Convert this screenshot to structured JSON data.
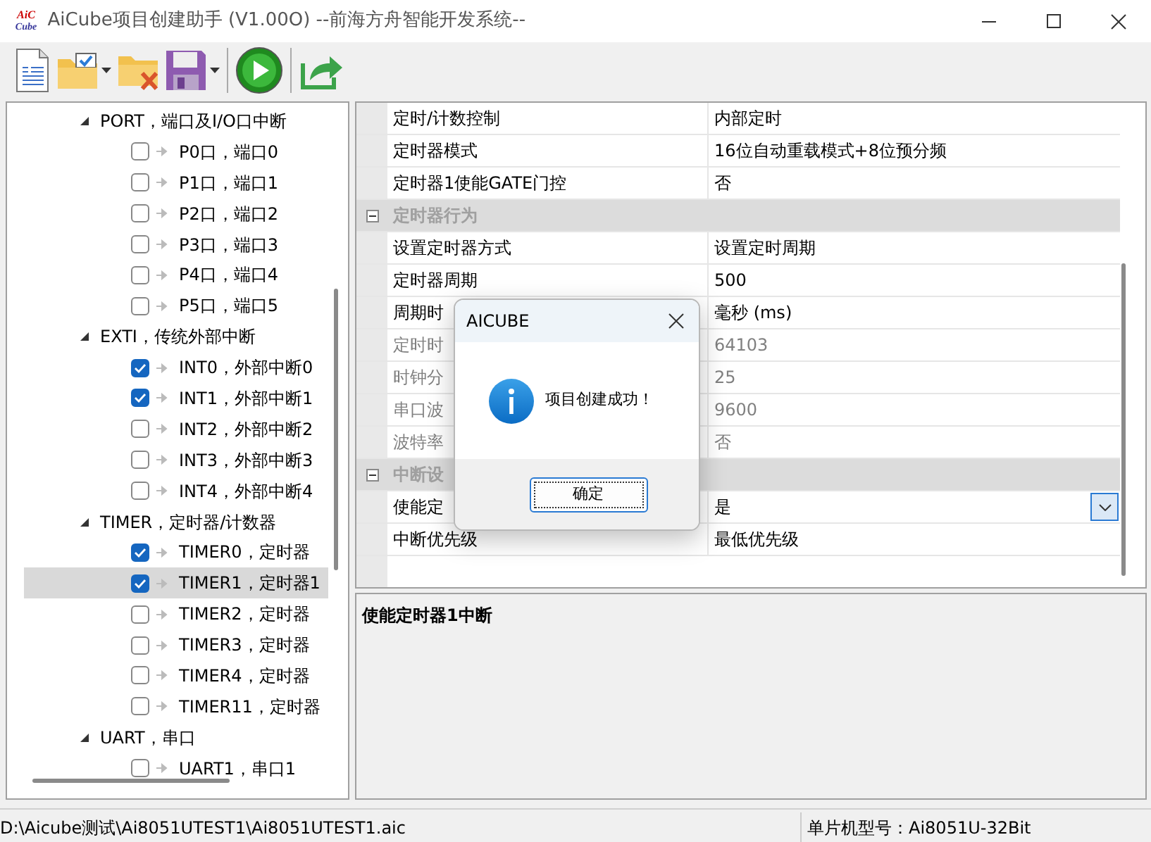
{
  "window": {
    "title": "AiCube项目创建助手 (V1.00O) --前海方舟智能开发系统--",
    "logo_text": [
      "AiC",
      "Cube"
    ]
  },
  "toolbar": [
    {
      "kind": "new-document",
      "menu": false
    },
    {
      "kind": "open-folder",
      "menu": true
    },
    {
      "kind": "close-folder",
      "menu": false
    },
    {
      "kind": "save",
      "menu": true
    },
    {
      "kind": "separator"
    },
    {
      "kind": "run",
      "menu": false
    },
    {
      "kind": "separator"
    },
    {
      "kind": "export",
      "menu": false
    }
  ],
  "tree": [
    {
      "label": "PORT，端口及I/O口中断",
      "expanded": true,
      "children": [
        {
          "label": "P0口，端口0",
          "checked": false,
          "selected": false
        },
        {
          "label": "P1口，端口1",
          "checked": false,
          "selected": false
        },
        {
          "label": "P2口，端口2",
          "checked": false,
          "selected": false
        },
        {
          "label": "P3口，端口3",
          "checked": false,
          "selected": false
        },
        {
          "label": "P4口，端口4",
          "checked": false,
          "selected": false
        },
        {
          "label": "P5口，端口5",
          "checked": false,
          "selected": false
        }
      ]
    },
    {
      "label": "EXTI，传统外部中断",
      "expanded": true,
      "children": [
        {
          "label": "INT0，外部中断0",
          "checked": true,
          "selected": false
        },
        {
          "label": "INT1，外部中断1",
          "checked": true,
          "selected": false
        },
        {
          "label": "INT2，外部中断2",
          "checked": false,
          "selected": false
        },
        {
          "label": "INT3，外部中断3",
          "checked": false,
          "selected": false
        },
        {
          "label": "INT4，外部中断4",
          "checked": false,
          "selected": false
        }
      ]
    },
    {
      "label": "TIMER，定时器/计数器",
      "expanded": true,
      "children": [
        {
          "label": "TIMER0，定时器",
          "checked": true,
          "selected": false
        },
        {
          "label": "TIMER1，定时器1",
          "checked": true,
          "selected": true
        },
        {
          "label": "TIMER2，定时器",
          "checked": false,
          "selected": false
        },
        {
          "label": "TIMER3，定时器",
          "checked": false,
          "selected": false
        },
        {
          "label": "TIMER4，定时器",
          "checked": false,
          "selected": false
        },
        {
          "label": "TIMER11，定时器",
          "checked": false,
          "selected": false
        }
      ]
    },
    {
      "label": "UART，串口",
      "expanded": true,
      "children": [
        {
          "label": "UART1，串口1",
          "checked": false,
          "selected": false
        }
      ]
    }
  ],
  "properties": [
    {
      "kind": "property",
      "name": "定时/计数控制",
      "value": "内部定时",
      "readonly": false
    },
    {
      "kind": "property",
      "name": "定时器模式",
      "value": "16位自动重载模式+8位预分频",
      "readonly": false
    },
    {
      "kind": "property",
      "name": "定时器1使能GATE门控",
      "value": "否",
      "readonly": false
    },
    {
      "kind": "group",
      "name": "定时器行为",
      "expanded": true
    },
    {
      "kind": "property",
      "name": "设置定时器方式",
      "value": "设置定时周期",
      "readonly": false
    },
    {
      "kind": "property",
      "name": "定时器周期",
      "value": "500",
      "readonly": false
    },
    {
      "kind": "property",
      "name": "周期时",
      "value": "毫秒 (ms)",
      "readonly": false
    },
    {
      "kind": "property",
      "name": "定时时",
      "value": "64103",
      "readonly": true
    },
    {
      "kind": "property",
      "name": "时钟分",
      "value": "25",
      "readonly": true
    },
    {
      "kind": "property",
      "name": "串口波",
      "value": "9600",
      "readonly": true
    },
    {
      "kind": "property",
      "name": "波特率",
      "value": "否",
      "readonly": true
    },
    {
      "kind": "group",
      "name": "中断设",
      "expanded": true
    },
    {
      "kind": "property",
      "name": "使能定",
      "value": "是",
      "readonly": false,
      "dropdown": true
    },
    {
      "kind": "property",
      "name": "中断优先级",
      "value": "最低优先级",
      "readonly": false
    }
  ],
  "description": "使能定时器1中断",
  "status_bar": {
    "path": "D:\\Aicube测试\\Ai8051UTEST1\\Ai8051UTEST1.aic",
    "model": "单片机型号：Ai8051U-32Bit"
  },
  "dialog": {
    "title": "AICUBE",
    "message": "项目创建成功！",
    "button": "确定"
  }
}
